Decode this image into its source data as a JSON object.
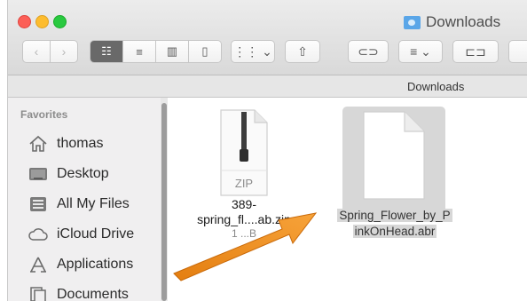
{
  "window": {
    "title": "Downloads",
    "path_title": "Downloads"
  },
  "toolbar": {
    "back": "‹",
    "forward": "›",
    "view_icons": "☷",
    "view_list": "≡",
    "view_columns": "▥",
    "view_coverflow": "▯",
    "arrange": "⋮⋮ ⌄",
    "share": "⇧",
    "tag": "⊂⊃",
    "action": "≡ ⌄",
    "newfolder": "⊏⊐"
  },
  "sidebar": {
    "header": "Favorites",
    "items": [
      {
        "label": "thomas",
        "icon": "home-icon"
      },
      {
        "label": "Desktop",
        "icon": "desktop-icon"
      },
      {
        "label": "All My Files",
        "icon": "all-files-icon"
      },
      {
        "label": "iCloud Drive",
        "icon": "cloud-icon"
      },
      {
        "label": "Applications",
        "icon": "applications-icon"
      },
      {
        "label": "Documents",
        "icon": "documents-icon"
      }
    ]
  },
  "files": [
    {
      "name_line1": "389-",
      "name_line2": "spring_fl....ab.zip",
      "sub": "1 ...B",
      "type_label": "ZIP"
    },
    {
      "name_line1": "Spring_Flower_by_P",
      "name_line2": "inkOnHead.abr",
      "selected": true
    }
  ],
  "colors": {
    "arrow": "#f0941d",
    "selection": "#d7d7d7"
  }
}
